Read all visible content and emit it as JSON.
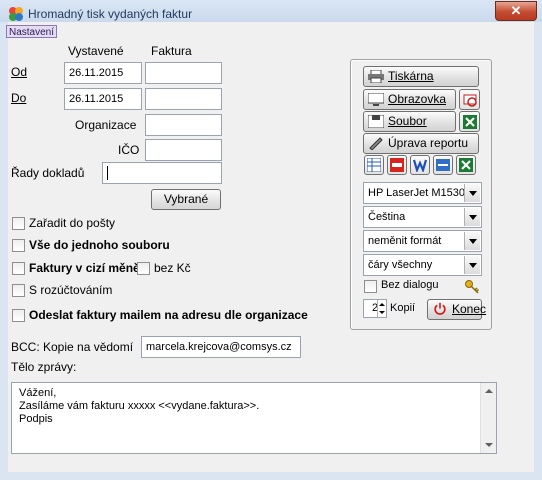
{
  "window": {
    "title": "Hromadný tisk vydaných faktur",
    "close_label": "✕"
  },
  "menu": {
    "nastaveni": "Nastavení"
  },
  "headers": {
    "vystavene": "Vystavené",
    "faktura": "Faktura"
  },
  "od": {
    "label": "Od",
    "vystavene": "26.11.2015",
    "faktura": ""
  },
  "do": {
    "label": "Do",
    "vystavene": "26.11.2015",
    "faktura": ""
  },
  "organizace": {
    "label": "Organizace",
    "value": ""
  },
  "ico": {
    "label": "IČO",
    "value": ""
  },
  "rady": {
    "label": "Řady dokladů",
    "value": "",
    "button": "Vybrané"
  },
  "checkboxes": {
    "zaradit": "Zařadit do pošty",
    "vse_jeden": "Vše do jednoho souboru",
    "cizi_mena": "Faktury v cizí měně",
    "bez_kc": "bez Kč",
    "rozuctovani": "S rozúčtováním",
    "odeslat": "Odeslat faktury mailem na adresu dle organizace"
  },
  "bcc": {
    "label": "BCC: Kopie na vědomí",
    "value": "marcela.krejcova@comsys.cz"
  },
  "telo": {
    "label": "Tělo zprávy:",
    "line1": "Vážení,",
    "line2": "Zasíláme vám fakturu xxxxx <<vydane.faktura>>.",
    "line3": "Podpis"
  },
  "panel": {
    "tiskarna": "Tiskárna",
    "obrazovka": "Obrazovka",
    "soubor": "Soubor",
    "uprava": "Úprava reportu",
    "printer": "HP LaserJet M1530",
    "language": "Čeština",
    "format": "neměnit formát",
    "lines": "čáry všechny",
    "bez_dialogu": "Bez dialogu",
    "kopie_value": "2",
    "kopie_label": "Kopií",
    "konec": "Konec"
  },
  "icons": {
    "app": "app-icon",
    "printer": "printer-icon",
    "screen": "screen-icon",
    "file": "file-icon",
    "edit": "edit-report-icon",
    "excel": "excel-icon",
    "mail": "email-icon",
    "pdf": "pdf-icon",
    "word": "word-icon",
    "html": "html-icon",
    "calc": "spreadsheet-icon",
    "keys": "keys-icon",
    "power": "power-icon"
  },
  "colors": {
    "title_text": "#1e395b",
    "close": "#c44b31",
    "excel": "#1d7a35",
    "power": "#d21a1a",
    "word": "#1f4fb3"
  }
}
